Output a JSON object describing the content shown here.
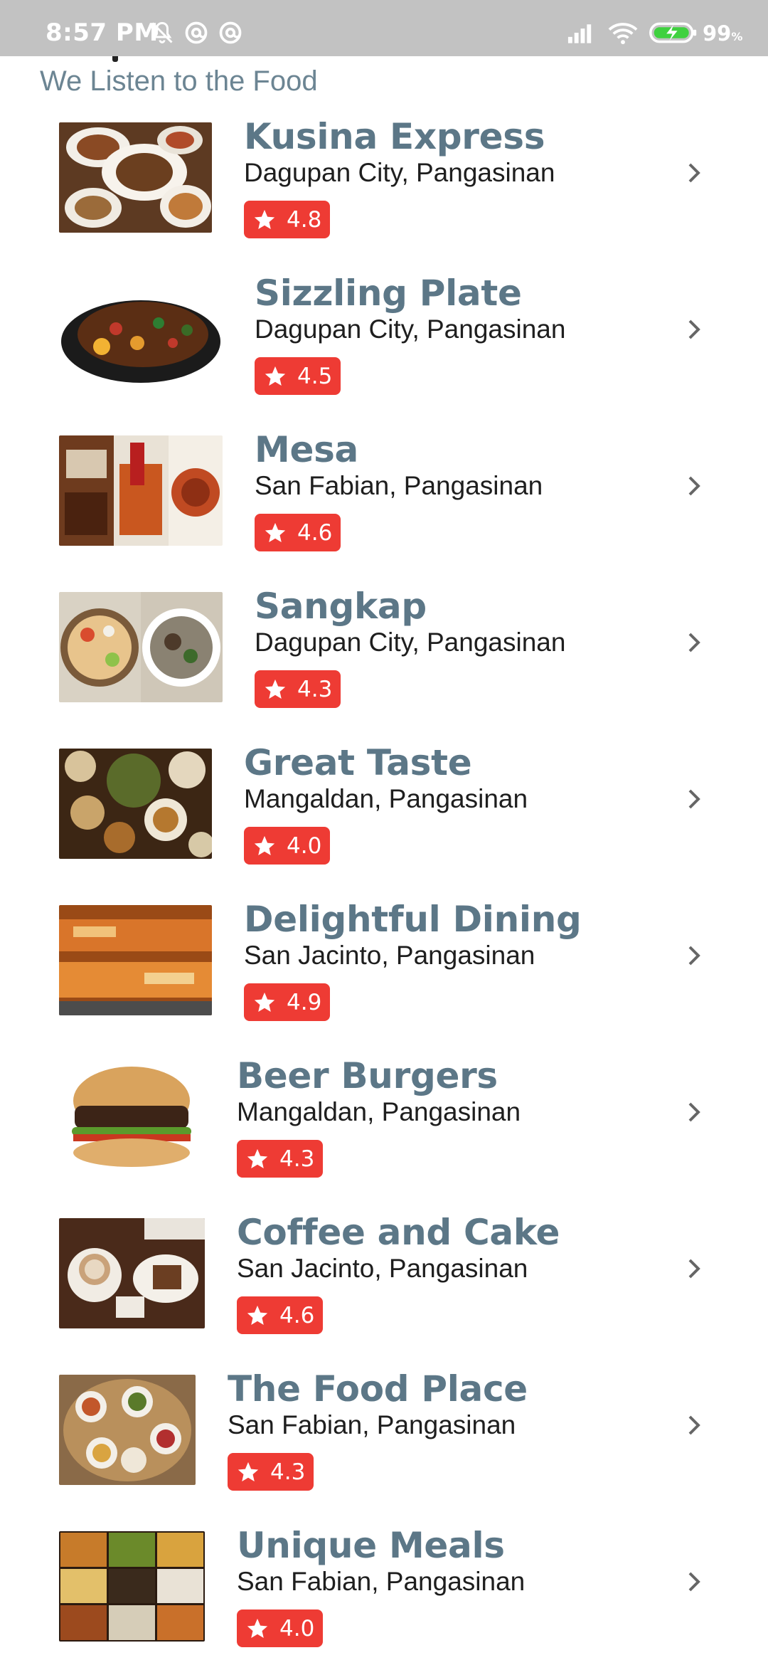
{
  "status_bar": {
    "time": "8:57 PM",
    "battery_percent": "99",
    "battery_unit": "%",
    "icons": [
      "bell-off-icon",
      "at-sign-icon",
      "at-sign-icon",
      "signal-icon",
      "wifi-icon",
      "battery-charging-icon"
    ]
  },
  "header": {
    "subtitle": "We Listen to the Food"
  },
  "colors": {
    "name_text": "#5c7787",
    "rating_badge": "#ee3b34",
    "status_bar": "#c2c2c2"
  },
  "restaurants": [
    {
      "name": "Kusina Express",
      "location": "Dagupan City, Pangasinan",
      "rating": "4.8"
    },
    {
      "name": "Sizzling Plate",
      "location": "Dagupan City, Pangasinan",
      "rating": "4.5"
    },
    {
      "name": "Mesa",
      "location": "San Fabian, Pangasinan",
      "rating": "4.6"
    },
    {
      "name": "Sangkap",
      "location": "Dagupan City, Pangasinan",
      "rating": "4.3"
    },
    {
      "name": "Great Taste",
      "location": "Mangaldan, Pangasinan",
      "rating": "4.0"
    },
    {
      "name": "Delightful Dining",
      "location": "San Jacinto, Pangasinan",
      "rating": "4.9"
    },
    {
      "name": "Beer Burgers",
      "location": "Mangaldan, Pangasinan",
      "rating": "4.3"
    },
    {
      "name": "Coffee and Cake",
      "location": "San Jacinto, Pangasinan",
      "rating": "4.6"
    },
    {
      "name": "The Food Place",
      "location": "San Fabian, Pangasinan",
      "rating": "4.3"
    },
    {
      "name": "Unique Meals",
      "location": "San Fabian, Pangasinan",
      "rating": "4.0"
    }
  ]
}
